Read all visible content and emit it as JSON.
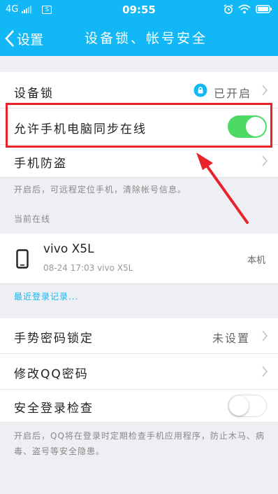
{
  "status_bar": {
    "network": "4G",
    "sim_label": "S",
    "time": "09:55",
    "icons": [
      "alarm-icon",
      "wifi-icon",
      "battery-icon"
    ]
  },
  "nav": {
    "back_label": "设置",
    "title": "设备锁、帐号安全"
  },
  "device_lock": {
    "label": "设备锁",
    "status": "已开启"
  },
  "allow_online": {
    "label": "允许手机电脑同步在线",
    "enabled": true
  },
  "anti_theft": {
    "label": "手机防盗",
    "note": "开启后，可远程定位手机，清除帐号信息。"
  },
  "online_section": {
    "title": "当前在线",
    "device_name": "vivo X5L",
    "device_detail": "08-24 17:03 vivo X5L",
    "device_tag": "本机"
  },
  "recent_login_link": "最近登录记录...",
  "gesture_lock": {
    "label": "手势密码锁定",
    "value": "未设置"
  },
  "change_password": {
    "label": "修改QQ密码"
  },
  "safe_login_check": {
    "label": "安全登录检查",
    "enabled": false,
    "note": "开启后，QQ将在登录时定期检查手机应用程序，防止木马、病毒、盗号等安全隐患。"
  },
  "colors": {
    "accent": "#12b7f5",
    "toggle_on": "#4cd964",
    "highlight": "#e8232a"
  }
}
